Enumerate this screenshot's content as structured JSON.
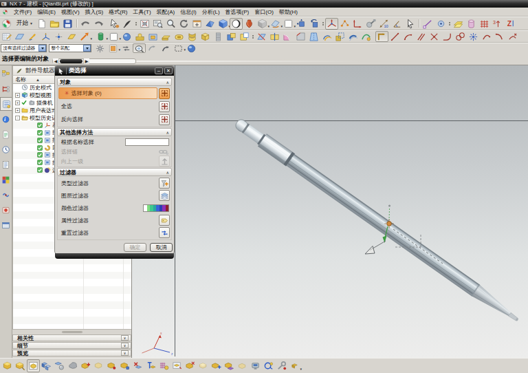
{
  "window": {
    "title": "NX 7 - 建模 - [QianBi.prt (修改的) ]"
  },
  "menu": {
    "items": [
      "文件(F)",
      "编辑(E)",
      "视图(V)",
      "插入(S)",
      "格式(R)",
      "工具(T)",
      "装配(A)",
      "信息(I)",
      "分析(L)",
      "首选项(P)",
      "窗口(O)",
      "帮助(H)"
    ]
  },
  "toolbars": {
    "standard": {
      "start_label": "开始",
      "row1": [
        {
          "n": "nx-start-menu-icon",
          "i": "nxstart"
        },
        {
          "n": "start-button",
          "start": true
        },
        {
          "n": "new-part-button",
          "i": "page"
        },
        {
          "n": "open-button",
          "i": "folder"
        },
        {
          "n": "save-button",
          "i": "floppy"
        },
        {
          "sep": true
        },
        {
          "n": "undo-button",
          "i": "undo"
        },
        {
          "n": "redo-button",
          "i": "redo"
        },
        {
          "gap": true
        },
        {
          "n": "touch-select-button",
          "i": "touchsel"
        },
        {
          "n": "pen-tool-button",
          "i": "pen"
        },
        {
          "dots": true
        },
        {
          "n": "fit-view-button",
          "i": "fitgrey"
        },
        {
          "n": "zoom-window-button",
          "i": "zoomwin"
        },
        {
          "n": "zoom-button",
          "i": "magnifier"
        },
        {
          "n": "rotate-view-button",
          "i": "rotview"
        },
        {
          "n": "pan-view-button",
          "i": "panwin"
        },
        {
          "n": "perspective-button",
          "i": "wedgeblue"
        },
        {
          "n": "shaded-view-button",
          "i": "cubeblue",
          "menu": true
        },
        {
          "n": "render-style-button",
          "i": "spherebw",
          "pressed": true
        },
        {
          "n": "true-shading-button",
          "i": "vase"
        },
        {
          "n": "facet-view-button",
          "i": "cubegrey",
          "menu": true
        },
        {
          "n": "section-view-button",
          "i": "clip",
          "menu": true
        },
        {
          "n": "show-hide-button",
          "i": "boxwhite",
          "menu": true
        },
        {
          "n": "move-object-button",
          "i": "moveblue"
        },
        {
          "n": "rotate-object-button",
          "i": "rotblue"
        },
        {
          "dots": true
        },
        {
          "n": "wcs-dynamics-button",
          "i": "csys",
          "pressed": true
        },
        {
          "n": "point-set-button",
          "i": "pointsor"
        },
        {
          "n": "vector-button",
          "i": "axesred"
        },
        {
          "n": "measure-body-button",
          "i": "hammer"
        },
        {
          "n": "measure-distance-button",
          "i": "measdist"
        },
        {
          "n": "measure-angle-button",
          "i": "measang"
        },
        {
          "n": "select-button",
          "i": "cursor"
        },
        {
          "sep": true
        },
        {
          "n": "snap-endpoint-button",
          "i": "snapend"
        },
        {
          "n": "snap-midpoint-button",
          "i": "snapmid"
        },
        {
          "dots": true
        },
        {
          "n": "snap-plane-button",
          "i": "snapplane"
        },
        {
          "n": "snap-face-button",
          "i": "snapcyl"
        },
        {
          "n": "snap-grid-button",
          "i": "snapgrid"
        },
        {
          "n": "snap-quadrant-button",
          "i": "snapquad"
        },
        {
          "n": "snap-point-button",
          "i": "snapz"
        }
      ],
      "row2": [
        {
          "n": "sketch-button",
          "i": "sketch"
        },
        {
          "n": "datum-plane-button",
          "i": "datplane"
        },
        {
          "n": "datum-axis-button",
          "i": "dataxis"
        },
        {
          "n": "datum-csys-button",
          "i": "datcsys"
        },
        {
          "n": "point-button",
          "i": "pointtool"
        },
        {
          "n": "plane-button",
          "i": "planegold"
        },
        {
          "n": "arrow-button",
          "i": "arrowor",
          "menu": true
        },
        {
          "gap": true
        },
        {
          "n": "hole-button",
          "i": "holegreen",
          "menu": true
        },
        {
          "n": "block-button",
          "i": "boxwhite",
          "menu": true
        },
        {
          "n": "sphere-button",
          "i": "sphblue"
        },
        {
          "n": "boss-button",
          "i": "bossgold"
        },
        {
          "n": "pocket-button",
          "i": "pocket"
        },
        {
          "n": "pad-button",
          "i": "padgold"
        },
        {
          "n": "slot-button",
          "i": "slotgold"
        },
        {
          "n": "groove-button",
          "i": "groovegold"
        },
        {
          "n": "shell-button",
          "i": "shellgold"
        },
        {
          "n": "thread-button",
          "i": "thread"
        },
        {
          "n": "unite-button",
          "i": "unite"
        },
        {
          "n": "subtract-button",
          "i": "subtract"
        },
        {
          "dots": true
        },
        {
          "n": "trim-body-button",
          "i": "trimb"
        },
        {
          "n": "split-body-button",
          "i": "splitb"
        },
        {
          "n": "blend-button",
          "i": "blendpink"
        },
        {
          "n": "chamfer-button",
          "i": "chamfer"
        },
        {
          "n": "draft-button",
          "i": "draft"
        },
        {
          "n": "offset-button",
          "i": "offsetf"
        },
        {
          "n": "scale-body-button",
          "i": "scaleb"
        },
        {
          "n": "thicken-button",
          "i": "thicken"
        },
        {
          "n": "wrap-button",
          "i": "wrapg"
        },
        {
          "gap": true
        },
        {
          "n": "profile-button",
          "i": "profile",
          "pressed": true
        },
        {
          "n": "line-button",
          "i": "redline"
        },
        {
          "n": "arc-button",
          "i": "redarc"
        },
        {
          "n": "derived-line-button",
          "i": "redpar"
        },
        {
          "n": "point-sketch-button",
          "i": "redpoint"
        },
        {
          "n": "fillet-button",
          "i": "redfillet"
        },
        {
          "n": "circle-button",
          "i": "redcircles"
        },
        {
          "n": "pattern-curve-button",
          "i": "redflower"
        },
        {
          "n": "arc2-button",
          "i": "redarc2"
        },
        {
          "n": "arc3-button",
          "i": "redarc3"
        },
        {
          "n": "quick-trim-button",
          "i": "redtrim"
        }
      ]
    },
    "assembly_bottom": [
      {
        "n": "find-component-button",
        "i": "goldbox"
      },
      {
        "n": "open-component-button",
        "i": "goldbox2"
      },
      {
        "n": "component-window-button",
        "i": "goldwin",
        "pressed": true
      },
      {
        "n": "blue-cubes-button",
        "i": "bluecubes"
      },
      {
        "n": "assembly-constraint-button",
        "i": "bluecubes2"
      },
      {
        "n": "grey-body-button",
        "i": "blobgrey"
      },
      {
        "n": "add-component-button",
        "i": "goldplus"
      },
      {
        "n": "new-component-button",
        "i": "goldpale"
      },
      {
        "n": "component-dot-button",
        "i": "goldred"
      },
      {
        "n": "component-blue-button",
        "i": "goldblue"
      },
      {
        "n": "suppress-component-button",
        "i": "redxblue"
      },
      {
        "n": "mirror-assembly-button",
        "i": "bluetgold"
      },
      {
        "n": "component-array-button",
        "i": "gridball"
      },
      {
        "n": "replace-component-button",
        "i": "goldwin2"
      },
      {
        "n": "move-component-button",
        "i": "goldredx"
      },
      {
        "n": "assembly-cut-button",
        "i": "goldpale2"
      },
      {
        "n": "new-parent-button",
        "i": "goldblueplus"
      },
      {
        "n": "exploded-view-button",
        "i": "goldpurple"
      },
      {
        "n": "sequence-button",
        "i": "goldpale3"
      },
      {
        "n": "clearance-device-button",
        "i": "device"
      },
      {
        "n": "check-clearance-button",
        "i": "bluecircle"
      },
      {
        "n": "wave-editor-button",
        "i": "wrenchgold"
      },
      {
        "n": "assembly-more-button",
        "i": "goldtiny",
        "menu": true
      }
    ],
    "selection_bar": {
      "type_filter_combo": "没有选择过滤器",
      "scope_combo": "整个装配",
      "icons": [
        {
          "n": "snap-settings-button",
          "i": "gearsnow"
        },
        {
          "n": "general-object-button",
          "i": "sqorange",
          "menu": true
        },
        {
          "n": "swap-button",
          "i": "swapsm"
        },
        {
          "n": "highlight-button",
          "i": "highmag",
          "pressed": true
        },
        {
          "n": "prev-selection-button",
          "i": "curva"
        },
        {
          "n": "select-prev-button",
          "i": "curvb"
        },
        {
          "n": "marquee-button",
          "i": "marquee",
          "menu": true
        },
        {
          "n": "ball-button",
          "i": "ballblue"
        }
      ]
    }
  },
  "cue_bar": {
    "text": "选择要编辑的对象"
  },
  "resource_bar": [
    {
      "n": "assembly-navigator-tab",
      "i": "rbassy"
    },
    {
      "n": "constraint-navigator-tab",
      "i": "rbconstr"
    },
    {
      "n": "part-navigator-tab",
      "i": "rbpart",
      "active": true
    },
    {
      "n": "internet-explorer-tab",
      "i": "rbie"
    },
    {
      "n": "history-page-tab",
      "i": "rbhistpage"
    },
    {
      "n": "history-tab",
      "i": "rbclock"
    },
    {
      "n": "system-materials-tab",
      "i": "rbnote"
    },
    {
      "n": "roles-tab",
      "i": "rbpalette"
    },
    {
      "n": "scenario-tab",
      "i": "rbbow"
    },
    {
      "n": "manufacturing-tab",
      "i": "rbred"
    },
    {
      "n": "window-tab",
      "i": "rbwin"
    }
  ],
  "navigator": {
    "title": "部件导航器",
    "column_header": "名称",
    "sort_icon": "▲",
    "items": [
      {
        "label": "历史模式",
        "icon": "clock",
        "indent": 0
      },
      {
        "label": "模型视图",
        "icon": "views",
        "expand": "+",
        "indent": 0
      },
      {
        "label": "摄像机",
        "icon": "camera",
        "check": true,
        "expand": "+",
        "indent": 0
      },
      {
        "label": "用户表达式",
        "icon": "foldercl",
        "expand": "+",
        "indent": 0
      },
      {
        "label": "模型历史记录",
        "icon": "folderop",
        "expand": "-",
        "indent": 0
      },
      {
        "label": "基准坐标系",
        "icon": "csyssm",
        "checkbox": true,
        "indent": 1
      },
      {
        "label": "拉伸",
        "icon": "extrblue",
        "checkbox": true,
        "indent": 1
      },
      {
        "label": "拉伸",
        "icon": "extrblue",
        "checkbox": true,
        "indent": 1
      },
      {
        "label": "回转",
        "icon": "revgold",
        "checkbox": true,
        "indent": 1
      },
      {
        "label": "拉伸",
        "icon": "extrblue",
        "checkbox": true,
        "indent": 1
      },
      {
        "label": "拉伸",
        "icon": "extrblue",
        "checkbox": true,
        "indent": 1
      },
      {
        "label": "边倒圆",
        "icon": "blendpurple",
        "checkbox": true,
        "indent": 1
      }
    ],
    "sections": [
      {
        "label": "相关性"
      },
      {
        "label": "细节"
      },
      {
        "label": "预览"
      }
    ]
  },
  "dialog": {
    "title": "类选择",
    "minimize_label": "–",
    "close_label": "✕",
    "groups": [
      {
        "header": "对象",
        "kind": "sel",
        "rows": [
          {
            "label": "选择对象 (0)",
            "selected": true,
            "button": "crosshair",
            "active": true
          },
          {
            "label": "全选",
            "button": "crosshair"
          },
          {
            "label": "反向选择",
            "button": "crosshair2"
          }
        ]
      },
      {
        "header": "其他选择方法",
        "kind": "mth",
        "rows": [
          {
            "label": "根据名称选择",
            "input": ""
          },
          {
            "label": "选择链",
            "disabled": true,
            "button": "chain",
            "noframe": true
          },
          {
            "label": "向上一级",
            "disabled": true,
            "button": "uplevel"
          }
        ]
      },
      {
        "header": "过滤器",
        "kind": "flt",
        "rows": [
          {
            "label": "类型过滤器",
            "button": "typefilter"
          },
          {
            "label": "图层过滤器",
            "button": "layerfilter"
          },
          {
            "label": "颜色过滤器",
            "colorstrip": [
              "#ffffff",
              "#7fdc7f",
              "#3fc98f",
              "#2aa9a0",
              "#3b63d9",
              "#2d3fb0",
              "#8c2fb8",
              "#8e1f2f"
            ]
          },
          {
            "label": "属性过滤器",
            "button": "attrfilter"
          },
          {
            "label": "重置过滤器",
            "button": "resetfilter"
          }
        ]
      }
    ],
    "ok_label": "确定",
    "cancel_label": "取消"
  },
  "scene": {
    "triad_labels": {
      "x": "x",
      "z": "z"
    }
  },
  "colors": {
    "accent_orange": "#ec9a4e",
    "titlebar_dark": "#1a1a1a",
    "graphics_top": "#b2b7ba",
    "graphics_bottom": "#ededec",
    "pencil_silver": "#c6ced4"
  }
}
